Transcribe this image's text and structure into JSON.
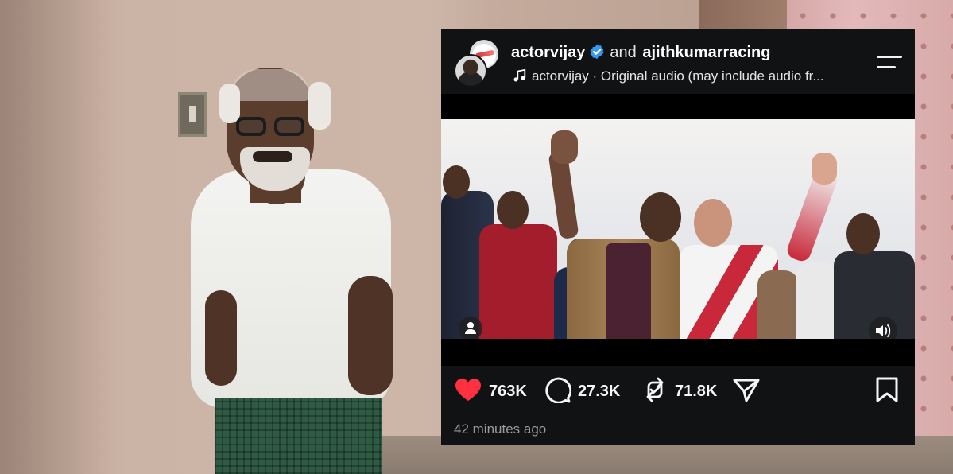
{
  "post": {
    "user_primary": "actorvijay",
    "conjunction": "and",
    "user_secondary": "ajithkumarracing",
    "audio_label": "actorvijay · Original audio (may include audio fr..."
  },
  "actions": {
    "likes": "763K",
    "comments": "27.3K",
    "reposts": "71.8K"
  },
  "timestamp": "42 minutes ago",
  "colors": {
    "like_red": "#ff3040",
    "verified_blue": "#3897f0",
    "card_bg": "#111214"
  },
  "icons": [
    "verified-badge-icon",
    "music-note-icon",
    "menu-icon",
    "user-tag-icon",
    "speaker-icon",
    "heart-icon",
    "comment-icon",
    "repost-icon",
    "share-icon",
    "bookmark-icon"
  ]
}
